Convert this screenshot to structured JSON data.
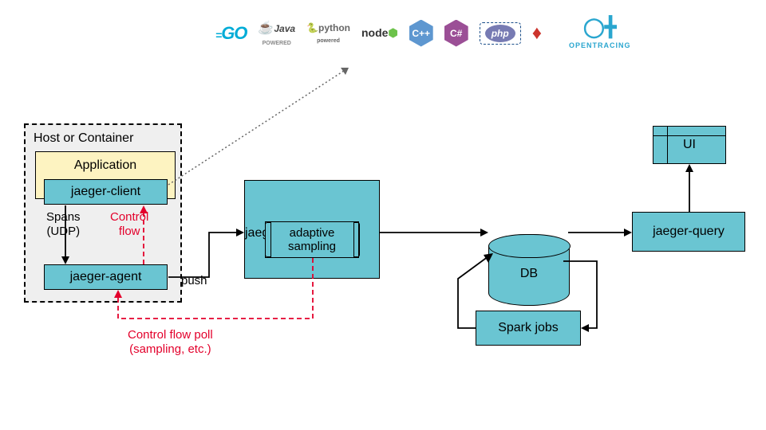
{
  "languages": {
    "go": "GO",
    "java": "Java",
    "java_sub": "POWERED",
    "python": "python",
    "python_sub": "powered",
    "node": "node",
    "cpp": "C++",
    "csharp": "C#",
    "php": "php",
    "ruby": "ruby",
    "opentracing": "OPENTRACING"
  },
  "host": {
    "title": "Host or Container",
    "app": "Application",
    "client": "jaeger-client",
    "agent": "jaeger-agent"
  },
  "collector": {
    "title": "jaeger-collector",
    "sampling": "adaptive\nsampling"
  },
  "db": "DB",
  "spark": "Spark jobs",
  "query": "jaeger-query",
  "ui": "UI",
  "labels": {
    "spans": "Spans\n(UDP)",
    "ctrl_flow": "Control\nflow",
    "push": "push",
    "poll": "Control flow poll\n(sampling, etc.)"
  },
  "colors": {
    "teal": "#6ac5d2",
    "cream": "#fdf3c1",
    "grey": "#efefef",
    "red": "#e3002b"
  }
}
